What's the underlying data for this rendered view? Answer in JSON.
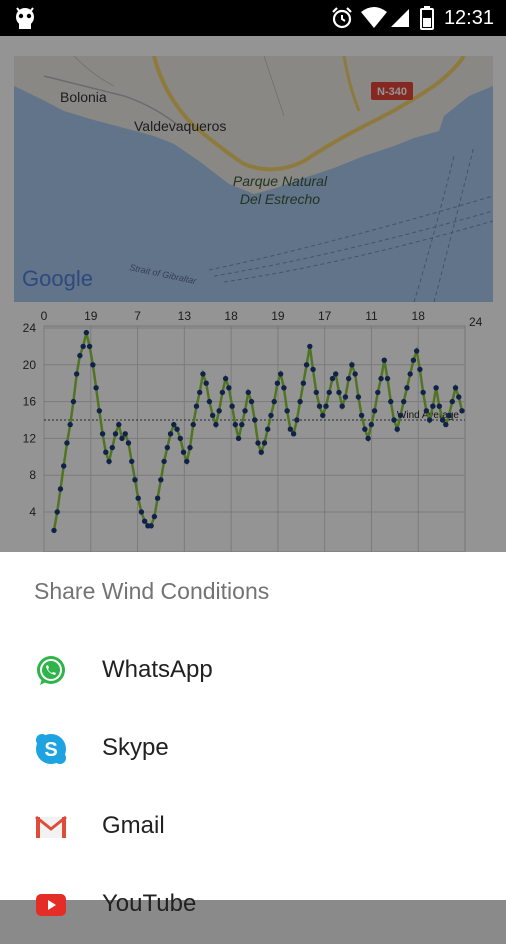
{
  "status_bar": {
    "time": "12:31",
    "icons": [
      "android-debug-icon",
      "alarm-icon",
      "wifi-icon",
      "signal-icon",
      "battery-icon"
    ]
  },
  "map": {
    "labels": {
      "bolonia": "Bolonia",
      "valdevaqueros": "Valdevaqueros",
      "parque_line1": "Parque Natural",
      "parque_line2": "Del Estrecho",
      "road": "N-340",
      "strait": "Strait of Gibraltar",
      "google": "Google"
    },
    "colors": {
      "sea": "#a8c8ee",
      "land": "#ecebe3",
      "road": "#f5d36a",
      "road_sign": "#e6453a"
    }
  },
  "chart_data": {
    "type": "scatter",
    "x_tick_labels": [
      "0",
      "19",
      "7",
      "13",
      "18",
      "19",
      "17",
      "11",
      "18"
    ],
    "right_label": "24",
    "y_tick_labels": [
      "24",
      "20",
      "16",
      "12",
      "8",
      "4"
    ],
    "ylim": [
      4,
      24
    ],
    "reference_line": {
      "y": 14,
      "label": "Wind Average"
    },
    "grid": true,
    "series": [
      {
        "values": [
          2,
          4,
          6.5,
          9,
          11.5,
          13.5,
          16,
          19,
          21,
          22,
          23.5,
          22,
          20,
          17.5,
          15,
          12.5,
          10.5,
          9.5,
          11,
          12.5,
          13.5,
          12,
          12.5,
          11.5,
          9.5,
          7.5,
          5.5,
          4,
          3,
          2.5,
          2.5,
          3.5,
          5.5,
          7.5,
          9.5,
          11,
          12.5,
          13.5,
          13,
          12,
          10.5,
          9.5,
          11,
          13.5,
          15.5,
          17,
          19,
          18,
          16,
          14.5,
          13.5,
          15,
          17,
          18.5,
          17.5,
          15.5,
          13.5,
          12,
          13.5,
          15,
          17,
          16,
          14,
          11.5,
          10.5,
          11.5,
          13,
          14.5,
          16,
          18,
          19,
          17.5,
          15,
          13,
          12.5,
          14,
          16,
          18,
          20,
          22,
          19.5,
          17,
          15.5,
          14.5,
          15.5,
          17,
          18.5,
          19,
          17,
          15.5,
          16.5,
          18.5,
          20,
          19,
          16.5,
          14.5,
          13,
          12,
          13.5,
          15,
          17,
          18.5,
          20.5,
          18.5,
          16,
          14,
          13,
          14.5,
          16,
          17.5,
          19,
          20.5,
          21.5,
          19.5,
          17,
          15,
          14,
          15.5,
          17.5,
          15.5,
          14,
          13.5,
          14.5,
          16,
          17.5,
          16.5,
          15
        ]
      }
    ],
    "colors": {
      "points": "#1c3c7c",
      "line": "#8cc83c",
      "grid": "#d4d4d4",
      "reference": "#444444"
    }
  },
  "share_sheet": {
    "title": "Share Wind Conditions",
    "items": [
      {
        "label": "WhatsApp",
        "icon": "whatsapp-icon"
      },
      {
        "label": "Skype",
        "icon": "skype-icon"
      },
      {
        "label": "Gmail",
        "icon": "gmail-icon"
      },
      {
        "label": "YouTube",
        "icon": "youtube-icon"
      }
    ]
  }
}
